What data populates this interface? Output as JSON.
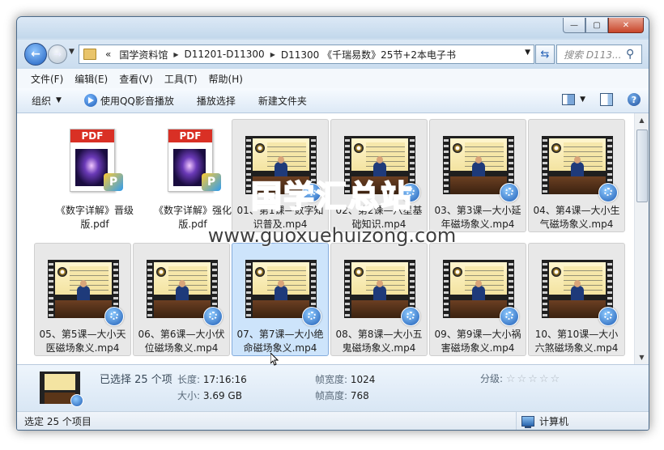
{
  "window": {
    "min_glyph": "—",
    "max_glyph": "▢",
    "close_glyph": "✕"
  },
  "address": {
    "lead": "«",
    "crumbs": [
      "国学资料馆",
      "D11201-D11300",
      "D11300 《千瑞易数》25节+2本电子书"
    ],
    "search_placeholder": "搜索 D113..."
  },
  "menu": [
    "文件(F)",
    "编辑(E)",
    "查看(V)",
    "工具(T)",
    "帮助(H)"
  ],
  "toolbar": {
    "organize": "组织",
    "play_qq": "使用QQ影音播放",
    "play_selection": "播放选择",
    "new_folder": "新建文件夹"
  },
  "files": [
    {
      "label": "《数字详解》晋级版.pdf",
      "kind": "pdf",
      "pdf_tag": "PDF",
      "badge": "P"
    },
    {
      "label": "《数字详解》强化版.pdf",
      "kind": "pdf",
      "pdf_tag": "PDF",
      "badge": "P"
    },
    {
      "label": "01、第1课—数字知识普及.mp4",
      "kind": "video"
    },
    {
      "label": "02、第2课—八星基础知识.mp4",
      "kind": "video"
    },
    {
      "label": "03、第3课—大小延年磁场象义.mp4",
      "kind": "video"
    },
    {
      "label": "04、第4课—大小生气磁场象义.mp4",
      "kind": "video"
    },
    {
      "label": "05、第5课—大小天医磁场象义.mp4",
      "kind": "video"
    },
    {
      "label": "06、第6课—大小伏位磁场象义.mp4",
      "kind": "video"
    },
    {
      "label": "07、第7课—大小绝命磁场象义.mp4",
      "kind": "video"
    },
    {
      "label": "08、第8课—大小五鬼磁场象义.mp4",
      "kind": "video"
    },
    {
      "label": "09、第9课—大小祸害磁场象义.mp4",
      "kind": "video"
    },
    {
      "label": "10、第10课—大小六煞磁场象义.mp4",
      "kind": "video"
    }
  ],
  "watermark": {
    "line1": "国学汇总站",
    "line2": "www.guoxuehuizong.com"
  },
  "details": {
    "selected": "已选择 25 个项",
    "duration_key": "长度:",
    "duration_val": "17:16:16",
    "size_key": "大小:",
    "size_val": "3.69 GB",
    "width_key": "帧宽度:",
    "width_val": "1024",
    "height_key": "帧高度:",
    "height_val": "768",
    "rating_key": "分级:",
    "rating_stars": "☆☆☆☆☆"
  },
  "status": {
    "left": "选定 25 个项目",
    "right": "计算机"
  }
}
